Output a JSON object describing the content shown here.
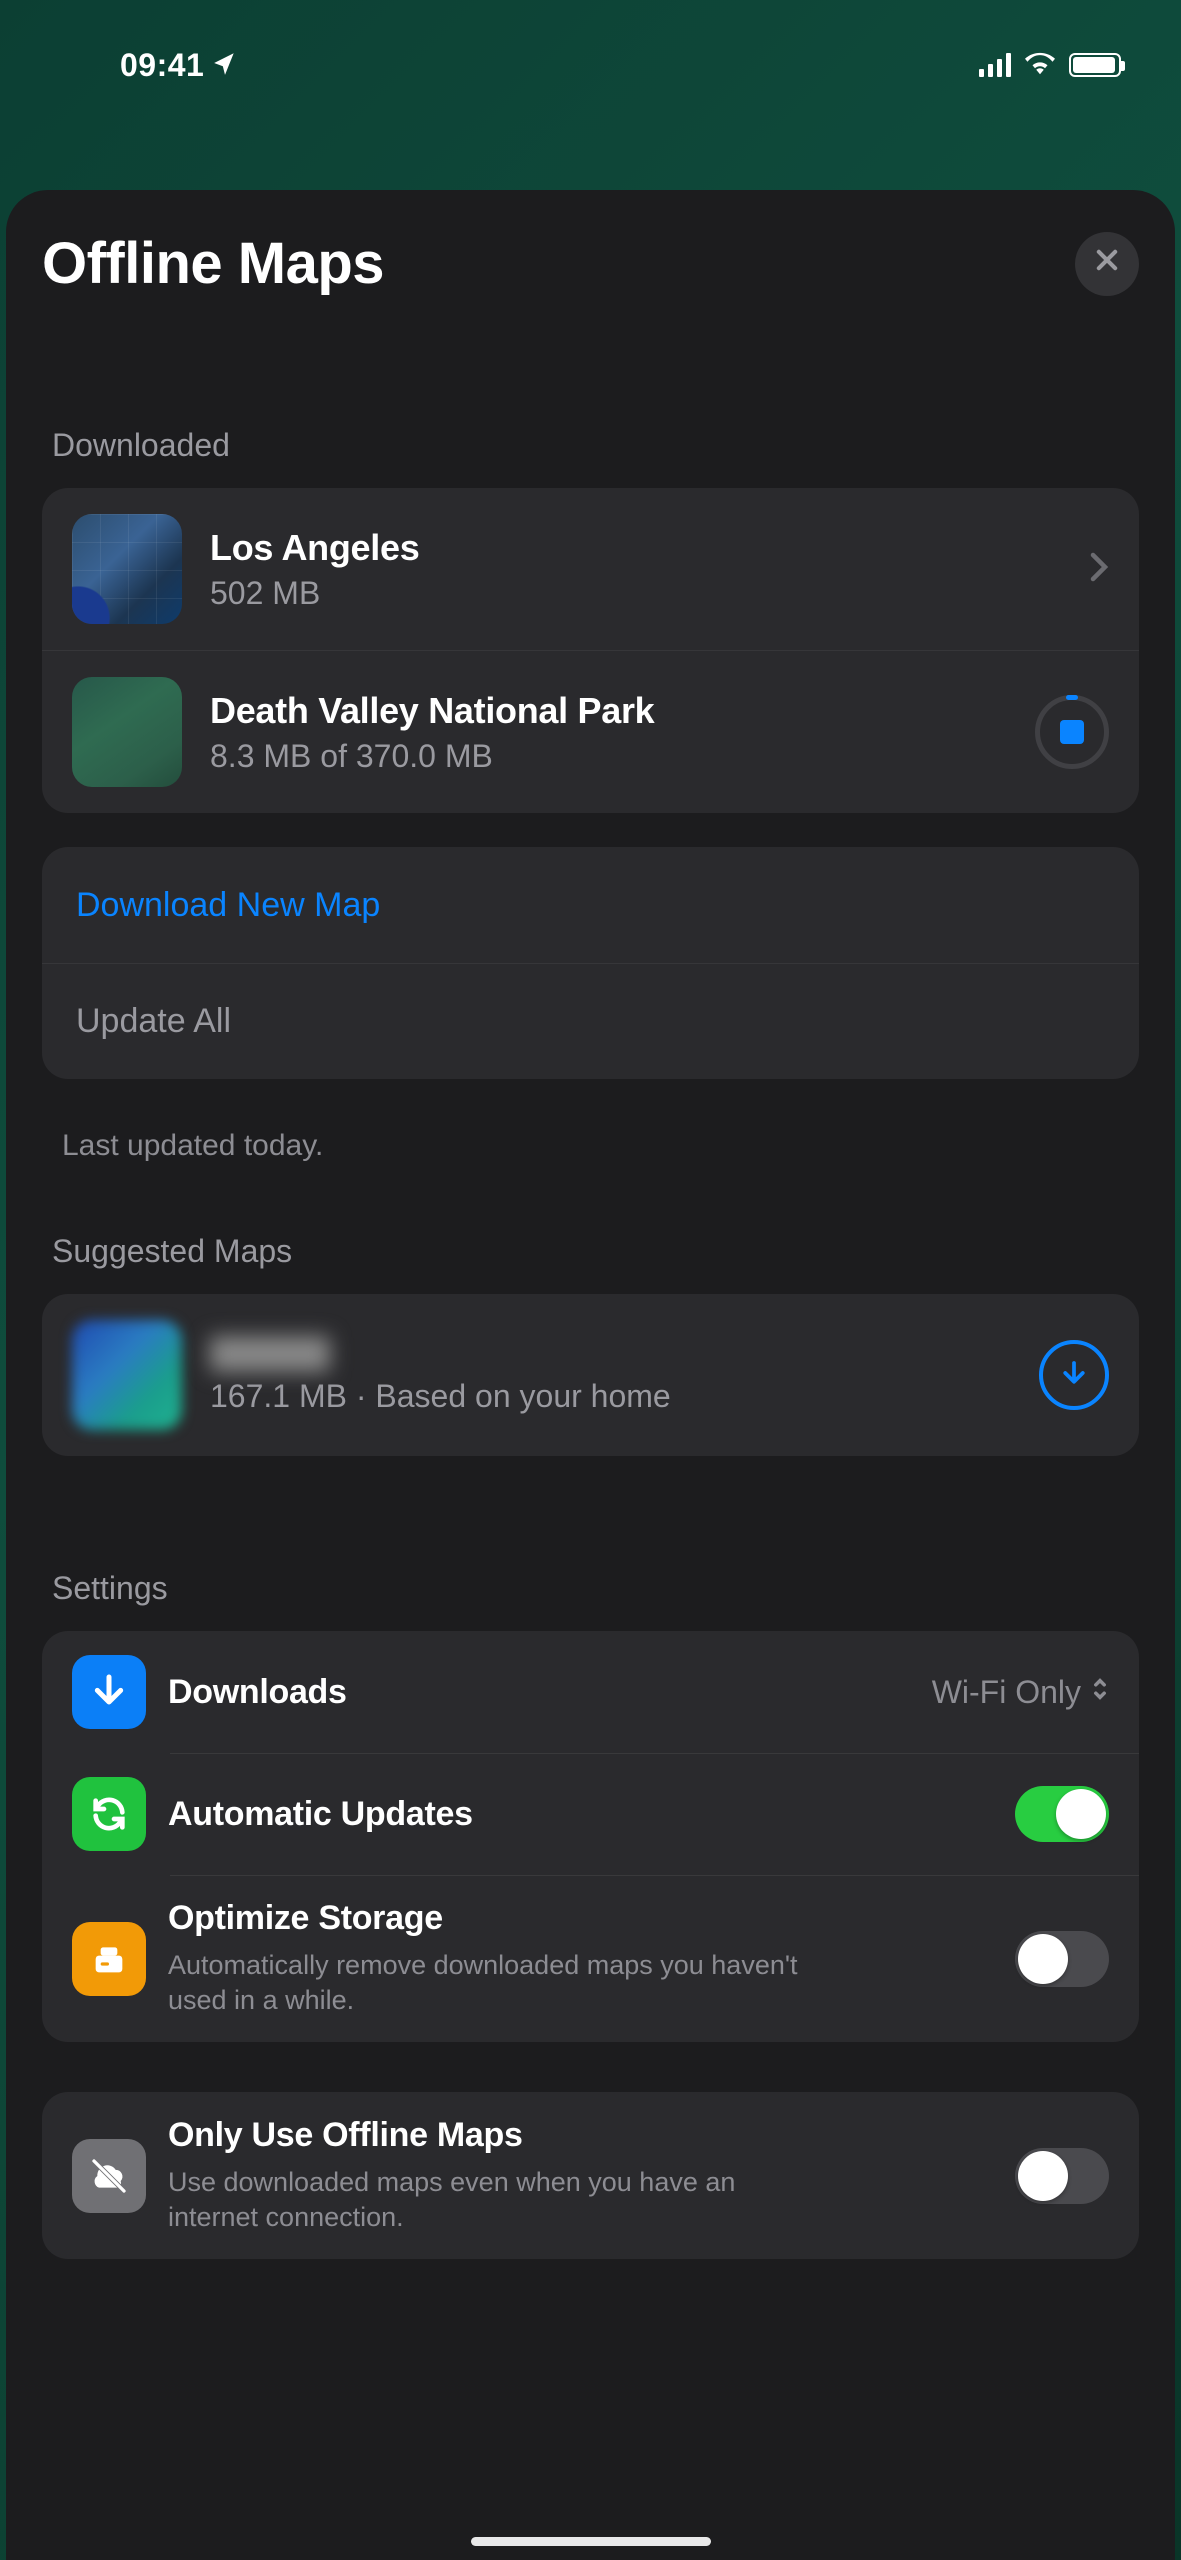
{
  "status": {
    "time": "09:41"
  },
  "sheet": {
    "title": "Offline Maps"
  },
  "sections": {
    "downloaded": {
      "header": "Downloaded",
      "items": [
        {
          "title": "Los Angeles",
          "subtitle": "502 MB",
          "state": "complete"
        },
        {
          "title": "Death Valley National Park",
          "subtitle": "8.3 MB of 370.0 MB",
          "state": "downloading"
        }
      ],
      "actions": {
        "download_new": "Download New Map",
        "update_all": "Update All"
      },
      "footer": "Last updated today."
    },
    "suggested": {
      "header": "Suggested Maps",
      "items": [
        {
          "title_redacted": true,
          "subtitle": "167.1 MB · Based on your home"
        }
      ]
    },
    "settings": {
      "header": "Settings",
      "rows": {
        "downloads": {
          "label": "Downloads",
          "value": "Wi-Fi Only"
        },
        "auto_updates": {
          "label": "Automatic Updates",
          "on": true
        },
        "optimize": {
          "label": "Optimize Storage",
          "desc": "Automatically remove downloaded maps you haven't used in a while.",
          "on": false
        },
        "offline_only": {
          "label": "Only Use Offline Maps",
          "desc": "Use downloaded maps even when you have an internet connection.",
          "on": false
        }
      }
    }
  },
  "colors": {
    "accent": "#0a84ff",
    "toggle_on": "#28cd41"
  }
}
